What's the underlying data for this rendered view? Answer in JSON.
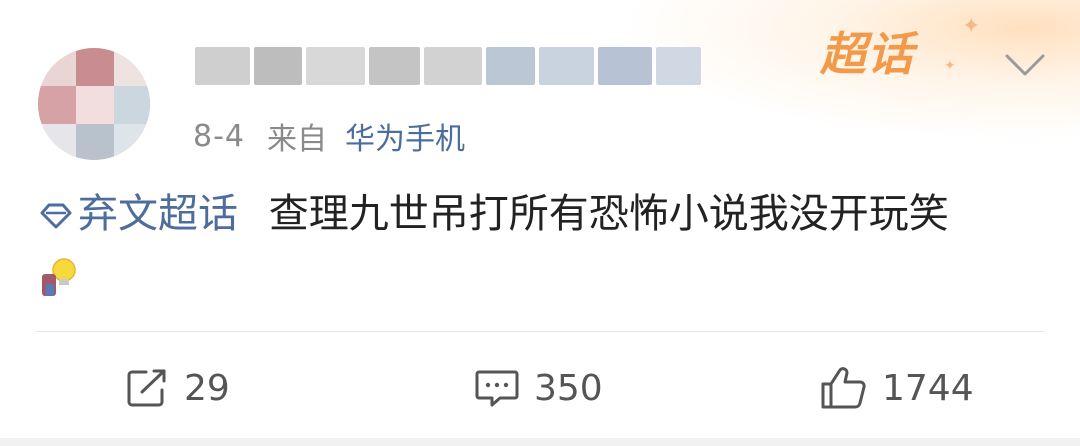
{
  "post": {
    "date": "8-4",
    "from_label": "来自",
    "device": "华为手机",
    "topic": "弃文超话",
    "text": "查理九世吊打所有恐怖小说我没开玩笑"
  },
  "badge": {
    "label": "超话"
  },
  "actions": {
    "repost_count": "29",
    "comment_count": "350",
    "like_count": "1744"
  },
  "colors": {
    "link": "#4d6d9c",
    "badge": "#f29a4a",
    "meta": "#8a8a8a"
  },
  "icons": [
    "avatar",
    "super-topic-badge",
    "chevron-down-icon",
    "topic-diamond-icon",
    "lightbulb-emoji",
    "repost-icon",
    "comment-icon",
    "like-icon"
  ]
}
